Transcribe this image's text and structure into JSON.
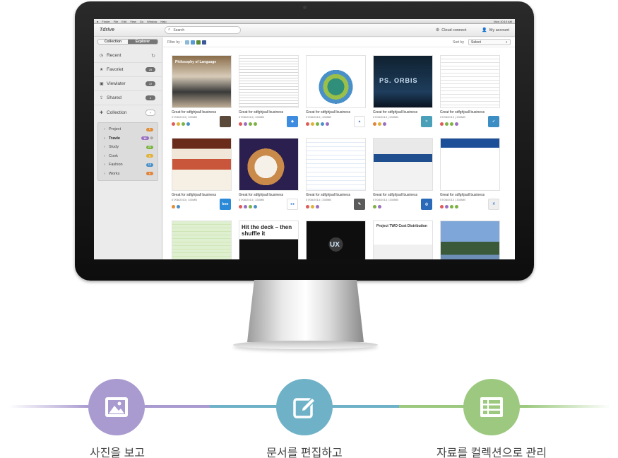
{
  "menubar": {
    "items": [
      "Finder",
      "File",
      "Edit",
      "View",
      "Go",
      "Window",
      "Help"
    ],
    "clock": "Mon 10:10 AM"
  },
  "header": {
    "logo": "Tdrive",
    "search_placeholder": "Search",
    "cloud_connect": "Cloud connect",
    "my_account": "My account"
  },
  "sidebar": {
    "tabs": [
      "Collection",
      "Explorer"
    ],
    "nav": [
      {
        "label": "Recent",
        "icon": "clock-icon"
      },
      {
        "label": "Favoriet",
        "count": "25",
        "icon": "star-icon"
      },
      {
        "label": "Viewlater",
        "count": "72",
        "icon": "bookmark-icon"
      },
      {
        "label": "Shared",
        "count": "2",
        "icon": "share-icon"
      },
      {
        "label": "Collection",
        "count": "+",
        "icon": "plus-icon"
      }
    ],
    "collections": [
      {
        "label": "Project",
        "count": "6",
        "color": "#e08f3a"
      },
      {
        "label": "Travle",
        "count": "10",
        "color": "#9a6fc0"
      },
      {
        "label": "Study",
        "count": "22",
        "color": "#7cb342"
      },
      {
        "label": "Cook",
        "count": "5",
        "color": "#e0b23a"
      },
      {
        "label": "Fashion",
        "count": "16",
        "color": "#4a90c8"
      },
      {
        "label": "Works",
        "count": "9",
        "color": "#e0843a"
      }
    ]
  },
  "filter": {
    "label": "Filter by :",
    "sort_label": "Sort by",
    "sort_value": "Select"
  },
  "cards": [
    {
      "title": "Great for sdfghjsall business",
      "meta": "07/08/2013  |  330MB",
      "badge": "instagram-icon",
      "badge_text": "",
      "badge_color": "#5b4a3a",
      "dots": [
        "#e05a5a",
        "#e0b23a",
        "#7cb342",
        "#4a90c8"
      ]
    },
    {
      "title": "Great for sdfghjsall business",
      "meta": "07/08/2013  |  330MB",
      "badge": "dropbox-icon",
      "badge_text": "◆",
      "badge_color": "#3d8ce0",
      "dots": [
        "#e05a5a",
        "#9a6fc0",
        "#7cb342",
        "#7cb342"
      ]
    },
    {
      "title": "Great for sdfghjsall business",
      "meta": "07/08/2013  |  330MB",
      "badge": "google-drive-icon",
      "badge_text": "▲",
      "badge_color": "#ffffff",
      "dots": [
        "#e05a5a",
        "#e0b23a",
        "#7cb342",
        "#4a90c8",
        "#9a6fc0"
      ]
    },
    {
      "title": "Great for sdfghjsall business",
      "meta": "07/08/2013  |  330MB",
      "badge": "cloud-app-icon",
      "badge_text": "≈",
      "badge_color": "#4aa0b8",
      "dots": [
        "#e0843a",
        "#e0b23a",
        "#9a6fc0"
      ]
    },
    {
      "title": "Great for sdfghjsall business",
      "meta": "07/08/2013  |  330MB",
      "badge": "feather-app-icon",
      "badge_text": "✓",
      "badge_color": "#3c8dc4",
      "dots": [
        "#e05a5a",
        "#7cb342",
        "#7cb342",
        "#9a6fc0"
      ]
    },
    {
      "title": "Great for sdfghjsall business",
      "meta": "07/08/2013  |  330MB",
      "badge": "box-icon",
      "badge_text": "box",
      "badge_color": "#2a8ad8",
      "dots": [
        "#e08f3a",
        "#4a90c8"
      ]
    },
    {
      "title": "Great for sdfghjsall business",
      "meta": "07/08/2013  |  330MB",
      "badge": "flickr-icon",
      "badge_text": "●●",
      "badge_color": "#ffffff",
      "dots": [
        "#e05a5a",
        "#9a6fc0",
        "#7cb342",
        "#4a90c8"
      ]
    },
    {
      "title": "Great for sdfghjsall business",
      "meta": "07/08/2013  |  330MB",
      "badge": "evernote-icon",
      "badge_text": "✎",
      "badge_color": "#5a5a5a",
      "dots": [
        "#e05a5a",
        "#e0b23a",
        "#9a6fc0"
      ]
    },
    {
      "title": "Great for sdfghjsall business",
      "meta": "07/08/2013  |  330MB",
      "badge": "camera-app-icon",
      "badge_text": "◎",
      "badge_color": "#2a6ab8",
      "dots": [
        "#7cb342",
        "#9a6fc0"
      ]
    },
    {
      "title": "Great for sdfghjsall business",
      "meta": "07/08/2013  |  330MB",
      "badge": "four-app-icon",
      "badge_text": "4",
      "badge_color": "#eeeeee",
      "dots": [
        "#e05a5a",
        "#9a6fc0",
        "#7cb342",
        "#7cb342"
      ]
    },
    {
      "title": "",
      "meta": "",
      "badge": "",
      "badge_text": "",
      "badge_color": "",
      "dots": []
    },
    {
      "title": "",
      "meta": "",
      "badge": "",
      "badge_text": "",
      "badge_color": "",
      "dots": []
    },
    {
      "title": "",
      "meta": "",
      "badge": "",
      "badge_text": "",
      "badge_color": "",
      "dots": []
    },
    {
      "title": "",
      "meta": "",
      "badge": "",
      "badge_text": "",
      "badge_color": "",
      "dots": []
    },
    {
      "title": "",
      "meta": "",
      "badge": "",
      "badge_text": "",
      "badge_color": "",
      "dots": []
    }
  ],
  "thumb_text": {
    "t1": "Philosophy of Language",
    "t4": "PS. ORBIS",
    "t12": "Hit the deck – then shuffle it",
    "t13": "UX",
    "t14": "Project TWO Cost Distribution"
  },
  "features": [
    {
      "label": "사진을 보고",
      "icon": "image-icon",
      "color": "#a99ad0",
      "line_color": "#a99ad0"
    },
    {
      "label": "문서를 편집하고",
      "icon": "edit-icon",
      "color": "#6fb2c8",
      "line_color": "#6fb2c8"
    },
    {
      "label": "자료를 컬렉션으로 관리",
      "icon": "list-icon",
      "color": "#9cc97f",
      "line_color": "#9cc97f"
    }
  ]
}
